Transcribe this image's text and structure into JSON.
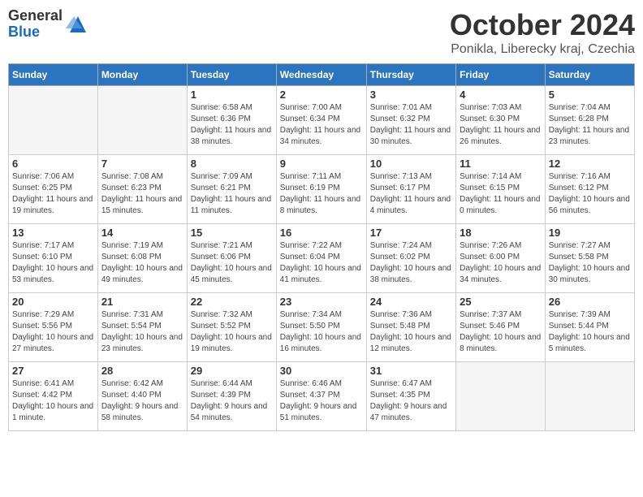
{
  "header": {
    "logo_general": "General",
    "logo_blue": "Blue",
    "title": "October 2024",
    "location": "Ponikla, Liberecky kraj, Czechia"
  },
  "days_of_week": [
    "Sunday",
    "Monday",
    "Tuesday",
    "Wednesday",
    "Thursday",
    "Friday",
    "Saturday"
  ],
  "weeks": [
    [
      {
        "day": "",
        "info": ""
      },
      {
        "day": "",
        "info": ""
      },
      {
        "day": "1",
        "info": "Sunrise: 6:58 AM\nSunset: 6:36 PM\nDaylight: 11 hours and 38 minutes."
      },
      {
        "day": "2",
        "info": "Sunrise: 7:00 AM\nSunset: 6:34 PM\nDaylight: 11 hours and 34 minutes."
      },
      {
        "day": "3",
        "info": "Sunrise: 7:01 AM\nSunset: 6:32 PM\nDaylight: 11 hours and 30 minutes."
      },
      {
        "day": "4",
        "info": "Sunrise: 7:03 AM\nSunset: 6:30 PM\nDaylight: 11 hours and 26 minutes."
      },
      {
        "day": "5",
        "info": "Sunrise: 7:04 AM\nSunset: 6:28 PM\nDaylight: 11 hours and 23 minutes."
      }
    ],
    [
      {
        "day": "6",
        "info": "Sunrise: 7:06 AM\nSunset: 6:25 PM\nDaylight: 11 hours and 19 minutes."
      },
      {
        "day": "7",
        "info": "Sunrise: 7:08 AM\nSunset: 6:23 PM\nDaylight: 11 hours and 15 minutes."
      },
      {
        "day": "8",
        "info": "Sunrise: 7:09 AM\nSunset: 6:21 PM\nDaylight: 11 hours and 11 minutes."
      },
      {
        "day": "9",
        "info": "Sunrise: 7:11 AM\nSunset: 6:19 PM\nDaylight: 11 hours and 8 minutes."
      },
      {
        "day": "10",
        "info": "Sunrise: 7:13 AM\nSunset: 6:17 PM\nDaylight: 11 hours and 4 minutes."
      },
      {
        "day": "11",
        "info": "Sunrise: 7:14 AM\nSunset: 6:15 PM\nDaylight: 11 hours and 0 minutes."
      },
      {
        "day": "12",
        "info": "Sunrise: 7:16 AM\nSunset: 6:12 PM\nDaylight: 10 hours and 56 minutes."
      }
    ],
    [
      {
        "day": "13",
        "info": "Sunrise: 7:17 AM\nSunset: 6:10 PM\nDaylight: 10 hours and 53 minutes."
      },
      {
        "day": "14",
        "info": "Sunrise: 7:19 AM\nSunset: 6:08 PM\nDaylight: 10 hours and 49 minutes."
      },
      {
        "day": "15",
        "info": "Sunrise: 7:21 AM\nSunset: 6:06 PM\nDaylight: 10 hours and 45 minutes."
      },
      {
        "day": "16",
        "info": "Sunrise: 7:22 AM\nSunset: 6:04 PM\nDaylight: 10 hours and 41 minutes."
      },
      {
        "day": "17",
        "info": "Sunrise: 7:24 AM\nSunset: 6:02 PM\nDaylight: 10 hours and 38 minutes."
      },
      {
        "day": "18",
        "info": "Sunrise: 7:26 AM\nSunset: 6:00 PM\nDaylight: 10 hours and 34 minutes."
      },
      {
        "day": "19",
        "info": "Sunrise: 7:27 AM\nSunset: 5:58 PM\nDaylight: 10 hours and 30 minutes."
      }
    ],
    [
      {
        "day": "20",
        "info": "Sunrise: 7:29 AM\nSunset: 5:56 PM\nDaylight: 10 hours and 27 minutes."
      },
      {
        "day": "21",
        "info": "Sunrise: 7:31 AM\nSunset: 5:54 PM\nDaylight: 10 hours and 23 minutes."
      },
      {
        "day": "22",
        "info": "Sunrise: 7:32 AM\nSunset: 5:52 PM\nDaylight: 10 hours and 19 minutes."
      },
      {
        "day": "23",
        "info": "Sunrise: 7:34 AM\nSunset: 5:50 PM\nDaylight: 10 hours and 16 minutes."
      },
      {
        "day": "24",
        "info": "Sunrise: 7:36 AM\nSunset: 5:48 PM\nDaylight: 10 hours and 12 minutes."
      },
      {
        "day": "25",
        "info": "Sunrise: 7:37 AM\nSunset: 5:46 PM\nDaylight: 10 hours and 8 minutes."
      },
      {
        "day": "26",
        "info": "Sunrise: 7:39 AM\nSunset: 5:44 PM\nDaylight: 10 hours and 5 minutes."
      }
    ],
    [
      {
        "day": "27",
        "info": "Sunrise: 6:41 AM\nSunset: 4:42 PM\nDaylight: 10 hours and 1 minute."
      },
      {
        "day": "28",
        "info": "Sunrise: 6:42 AM\nSunset: 4:40 PM\nDaylight: 9 hours and 58 minutes."
      },
      {
        "day": "29",
        "info": "Sunrise: 6:44 AM\nSunset: 4:39 PM\nDaylight: 9 hours and 54 minutes."
      },
      {
        "day": "30",
        "info": "Sunrise: 6:46 AM\nSunset: 4:37 PM\nDaylight: 9 hours and 51 minutes."
      },
      {
        "day": "31",
        "info": "Sunrise: 6:47 AM\nSunset: 4:35 PM\nDaylight: 9 hours and 47 minutes."
      },
      {
        "day": "",
        "info": ""
      },
      {
        "day": "",
        "info": ""
      }
    ]
  ]
}
